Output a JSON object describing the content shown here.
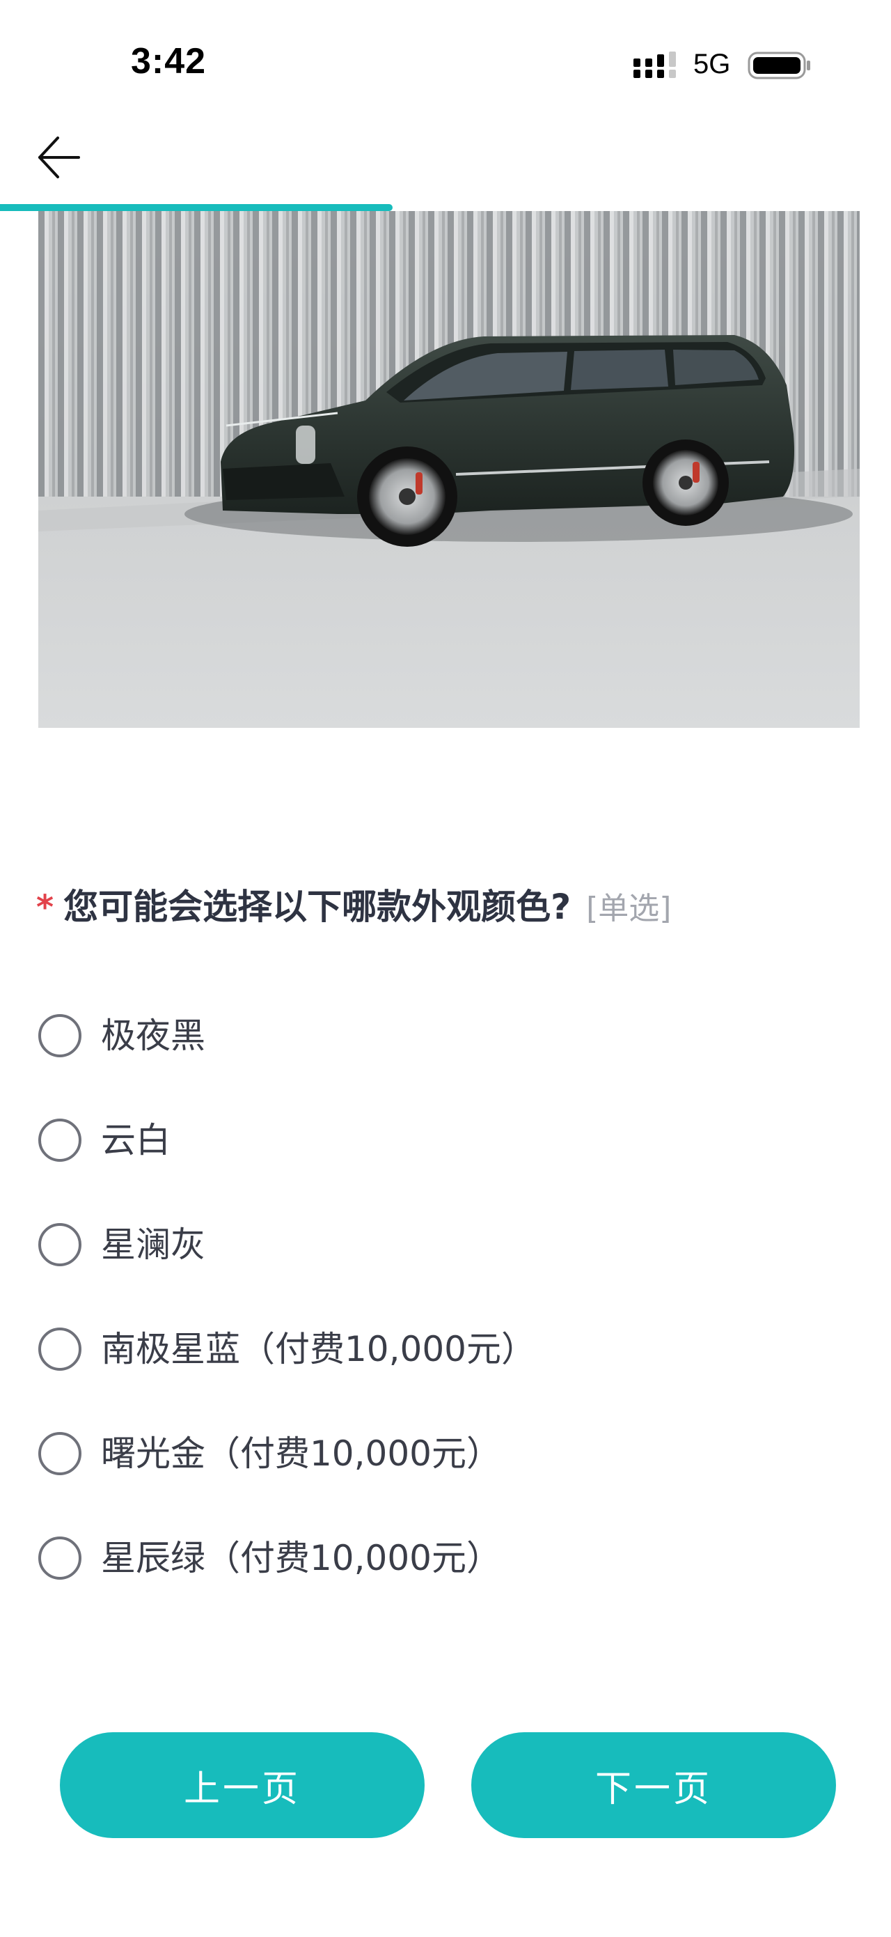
{
  "status_bar": {
    "time": "3:42",
    "network": "5G",
    "signal_icon": "cellular-signal-icon",
    "battery_icon": "battery-icon"
  },
  "header": {
    "back_icon": "arrow-left-icon"
  },
  "progress": {
    "fraction": 0.49,
    "color": "#17bcbc"
  },
  "hero": {
    "description_icon": "car-photo"
  },
  "question": {
    "required_mark": "*",
    "text": "您可能会选择以下哪款外观颜色?",
    "type": "[单选]"
  },
  "options": [
    {
      "label": "极夜黑"
    },
    {
      "label": "云白"
    },
    {
      "label": "星澜灰"
    },
    {
      "label": "南极星蓝（付费10,000元）"
    },
    {
      "label": "曙光金（付费10,000元）"
    },
    {
      "label": "星辰绿（付费10,000元）"
    }
  ],
  "footer": {
    "prev_label": "上一页",
    "next_label": "下一页"
  },
  "colors": {
    "accent": "#17bcbc",
    "required": "#e2424a",
    "text": "#2e3342",
    "muted": "#a3a6ae"
  }
}
